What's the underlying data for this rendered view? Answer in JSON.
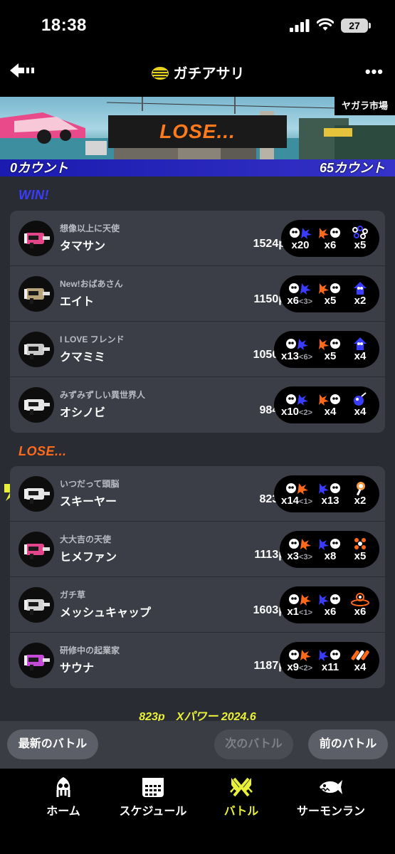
{
  "status_bar": {
    "time": "18:38",
    "battery": "27"
  },
  "header": {
    "title": "ガチアサリ",
    "back_icon": "back-arrow-icon",
    "more_label": "•••"
  },
  "banner": {
    "stage": "ヤガラ市場",
    "result": "LOSE...",
    "count_left": "0カウント",
    "count_right": "65カウント"
  },
  "colors": {
    "win": "#3a3cff",
    "lose": "#ff6a1a",
    "power": "#e8f03a",
    "active_tab": "#e8f03a"
  },
  "win": {
    "label": "WIN!",
    "players": [
      {
        "title": "想像以上に天使",
        "name": "タマサン",
        "points": "1524p",
        "kills": "x20",
        "deaths": "x6",
        "specials": "x5",
        "weapon_color": "#e2458a",
        "special_icon": "special-icon-rings"
      },
      {
        "title": "New!おばあさん",
        "name": "エイト",
        "points": "1150p",
        "kills": "x6",
        "assists": "<3>",
        "deaths": "x5",
        "specials": "x2",
        "weapon_color": "#b8a47a",
        "special_icon": "special-icon-squid-blue"
      },
      {
        "title": "I LOVE フレンド",
        "name": "クマミミ",
        "points": "1050p",
        "kills": "x13",
        "assists": "<6>",
        "deaths": "x5",
        "specials": "x4",
        "weapon_color": "#c9c9c9",
        "special_icon": "special-icon-squid-blue"
      },
      {
        "title": "みずみずしい異世界人",
        "name": "オシノビ",
        "points": "984p",
        "kills": "x10",
        "assists": "<2>",
        "deaths": "x4",
        "specials": "x4",
        "weapon_color": "#e6e6e6",
        "special_icon": "special-icon-bomb-blue"
      }
    ]
  },
  "lose": {
    "label": "LOSE...",
    "players": [
      {
        "title": "いつだって頭脳",
        "name": "スキーヤー",
        "points": "823p",
        "kills": "x14",
        "assists": "<1>",
        "deaths": "x13",
        "specials": "x2",
        "weapon_color": "#e6e6e6",
        "special_icon": "special-icon-hammer",
        "is_self": true
      },
      {
        "title": "大大吉の天使",
        "name": "ヒメファン",
        "points": "1113p",
        "kills": "x3",
        "assists": "<3>",
        "deaths": "x8",
        "specials": "x5",
        "weapon_color": "#e2458a",
        "special_icon": "special-icon-dots-orange"
      },
      {
        "title": "ガチ草",
        "name": "メッシュキャップ",
        "points": "1603p",
        "kills": "x1",
        "assists": "<1>",
        "deaths": "x6",
        "specials": "x6",
        "weapon_color": "#d4d4d4",
        "special_icon": "special-icon-target"
      },
      {
        "title": "研修中の起業家",
        "name": "サウナ",
        "points": "1187p",
        "kills": "x9",
        "assists": "<2>",
        "deaths": "x11",
        "specials": "x4",
        "weapon_color": "#c44bd6",
        "special_icon": "special-icon-missiles"
      }
    ]
  },
  "footer": {
    "power_text": "823p　Xパワー 2024.6"
  },
  "nav": {
    "latest": "最新のバトル",
    "next": "次のバトル",
    "prev": "前のバトル"
  },
  "tabs": [
    {
      "label": "ホーム",
      "icon": "squid-home-icon"
    },
    {
      "label": "スケジュール",
      "icon": "calendar-icon"
    },
    {
      "label": "バトル",
      "icon": "battle-icon",
      "active": true
    },
    {
      "label": "サーモンラン",
      "icon": "salmon-icon"
    }
  ]
}
